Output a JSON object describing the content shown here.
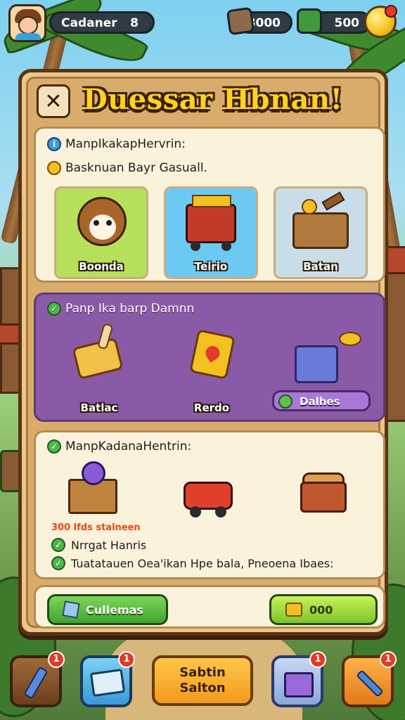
{
  "topbar": {
    "player_name": "Cadaner",
    "player_level": "8",
    "resource1_value": "8000",
    "resource2_value": "500",
    "avatar_icon": "player-avatar-icon",
    "resource1_icon": "gem-chest-icon",
    "resource2_icon": "crate-icon",
    "coin_icon": "coin-icon"
  },
  "panel": {
    "title": "Duessar Hbnan!",
    "close_icon": "close-x-icon"
  },
  "section1": {
    "heading": "ManpIkakapHervrin:",
    "subheading": "Basknuan Bayr Gasuall.",
    "cards": [
      {
        "label": "Boonda",
        "icon": "puppy-pet-icon",
        "bg": "#b6e05a"
      },
      {
        "label": "Teirio",
        "icon": "treasure-cart-icon",
        "bg": "#6ccaf2"
      },
      {
        "label": "Batan",
        "icon": "loot-crate-icon",
        "bg": "#c9dde8"
      }
    ]
  },
  "section2": {
    "heading": "Panp Ika barp Damnn",
    "items": [
      {
        "label": "Batlac",
        "icon": "bone-cheese-icon"
      },
      {
        "label": "Rerdo",
        "icon": "golden-ticket-icon"
      }
    ],
    "button_label": "Dalhes",
    "button_icon": "gift-box-icon"
  },
  "section3": {
    "heading": "ManpKadanaHentrin:",
    "items": [
      {
        "icon": "magic-crate-icon"
      },
      {
        "icon": "toy-car-icon"
      },
      {
        "icon": "wheeled-chest-icon"
      }
    ],
    "red_note": "300 lfds stalneen",
    "lines": [
      "Nrrgat Hanris",
      "Tuatatauen Oea'ikan Hpe bala, Pneoena Ibaes:"
    ]
  },
  "actions": {
    "left_button": "Cullemas",
    "right_button": "000"
  },
  "bottom_nav": {
    "btn1_icon": "paint-brush-icon",
    "btn1_badge": "1",
    "btn2_icon": "mail-box-icon",
    "btn2_badge": "1",
    "center_line1": "Sabtin",
    "center_line2": "Salton",
    "btn4_icon": "gift-icon",
    "btn4_badge": "1",
    "btn5_icon": "tools-icon",
    "btn5_badge": "1"
  },
  "colors": {
    "title_text": "#ffd21e",
    "panel_wood": "#e9c588",
    "purple_section": "#8a5aa6",
    "green_button": "#3ea42e",
    "lime_button": "#7dc42a",
    "orange_button": "#f29a1a",
    "badge_red": "#e33a2a"
  }
}
